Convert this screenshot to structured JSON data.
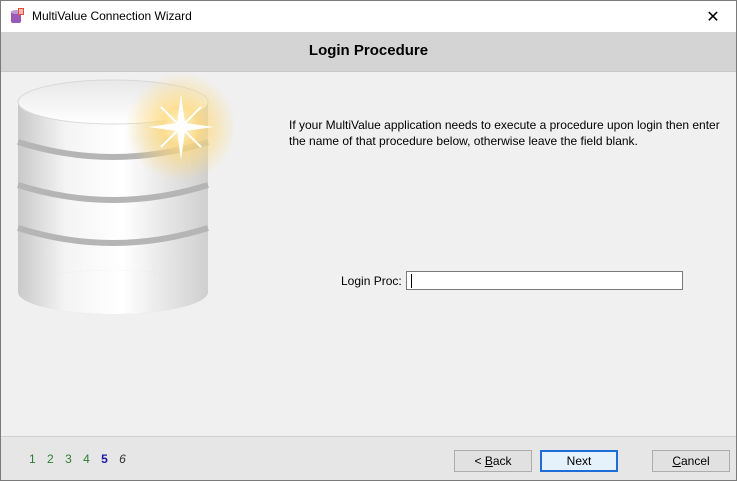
{
  "window": {
    "title": "MultiValue Connection Wizard",
    "close_symbol": "✕"
  },
  "header": {
    "title": "Login Procedure"
  },
  "main": {
    "description": "If your MultiValue application needs to execute a procedure upon login then enter the name of that procedure below, otherwise leave the field blank.",
    "login_proc_label": "Login Proc:",
    "login_proc_value": ""
  },
  "footer": {
    "steps": [
      {
        "label": "1",
        "state": "done"
      },
      {
        "label": "2",
        "state": "done"
      },
      {
        "label": "3",
        "state": "done"
      },
      {
        "label": "4",
        "state": "done"
      },
      {
        "label": "5",
        "state": "current"
      },
      {
        "label": "6",
        "state": "next"
      }
    ],
    "back_prefix": "< ",
    "back_key": "B",
    "back_rest": "ack",
    "next_label": "Next",
    "cancel_key": "C",
    "cancel_rest": "ancel"
  },
  "icons": {
    "app": "database-wizard-icon",
    "close": "close-icon",
    "illustration": "database-star-illustration"
  },
  "colors": {
    "step_done": "#2e7d32",
    "step_current": "#1a1aa6",
    "default_button_border": "#1e6cd8"
  }
}
